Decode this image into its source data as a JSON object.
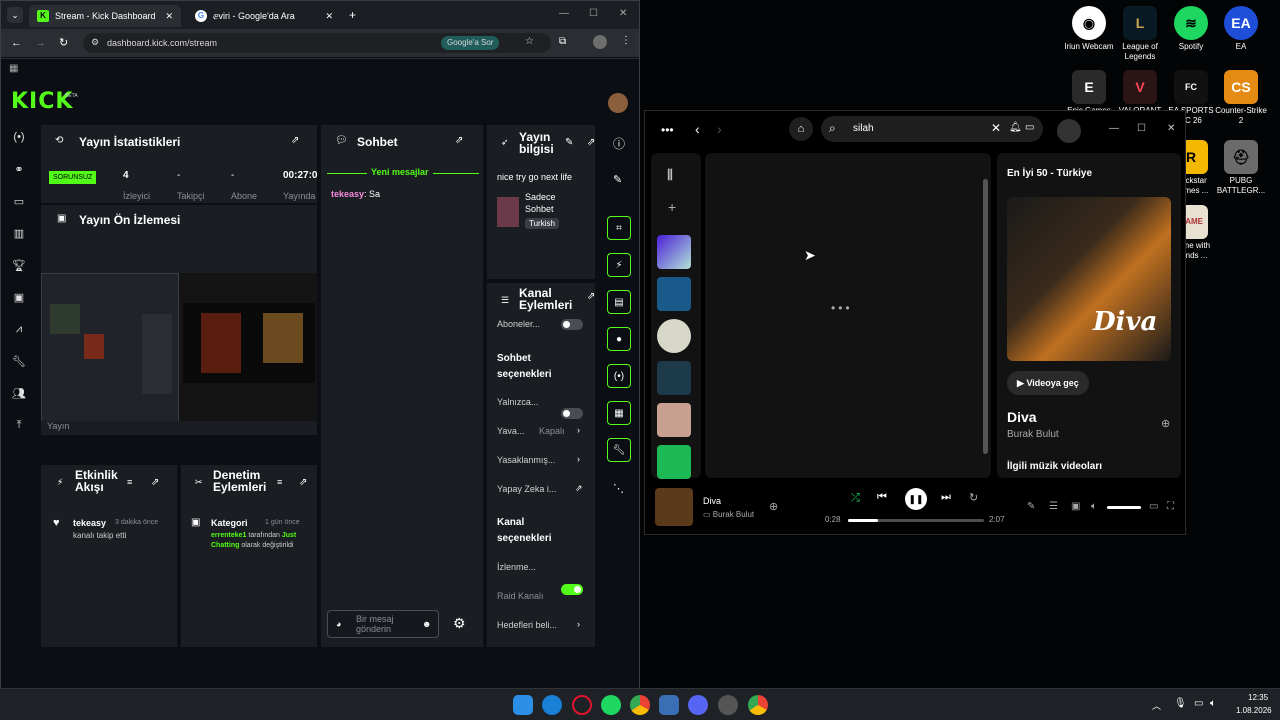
{
  "chrome": {
    "tab1": "Stream - Kick Dashboard",
    "tab2": "ⅇviri - Google'da Ara",
    "url": "dashboard.kick.com/stream",
    "ask_google": "Google'a Sor"
  },
  "kick": {
    "logo": "KICK",
    "beta": "BETA",
    "stats": {
      "title": "Yayın İstatistikleri",
      "badge": "SORUNSUZ",
      "viewers_val": "4",
      "viewers_lbl": "İzleyici",
      "followers_val": "-",
      "followers_lbl": "Takipçi",
      "subs_val": "-",
      "subs_lbl": "Abone",
      "time_val": "00:27:0",
      "time_lbl": "Yayında"
    },
    "preview": {
      "title": "Yayın Ön İzlemesi",
      "cut": "Yayın"
    },
    "chat": {
      "title": "Sohbet",
      "new_messages": "Yeni mesajlar",
      "user": "tekeasy",
      "msg": "Sa",
      "placeholder": "Bir mesaj gönderin"
    },
    "info": {
      "title": "Yayın bilgisi",
      "stream_title": "nice try go next life",
      "category": "Sadece Sohbet",
      "language": "Turkish"
    },
    "actions": {
      "title": "Kanal Eylemleri",
      "subs_only": "Aboneler...",
      "chat_options": "Sohbet seçenekleri",
      "only": "Yalnızca...",
      "slow": "Yava...",
      "slow_val": "Kapalı",
      "banned": "Yasaklanmış...",
      "ai": "Yapay Zeka i...",
      "channel_options": "Kanal seçenekleri",
      "watch": "İzlenme...",
      "raid": "Raid Kanalı",
      "goals": "Hedefleri beli..."
    },
    "activity": {
      "title": "Etkinlik Akışı",
      "user": "tekeasy",
      "time": "3 dakika önce",
      "text": "kanalı takip etti"
    },
    "mod": {
      "title": "Denetim Eylemleri",
      "kind": "Kategori",
      "time": "1 gün önce",
      "user": "errenteke1",
      "t1": "tarafından",
      "cat": "Just Chatting",
      "t2": "olarak değiştirildi"
    }
  },
  "desktop_icons": [
    "Iriun Webcam",
    "League of Legends",
    "Spotify",
    "EA",
    "Epic Games",
    "VALORANT",
    "EA SPORTS FC 26",
    "Counter-Strike 2",
    "Rockstar Games ...",
    "PUBG BATTLEGR...",
    "Game with friends ..."
  ],
  "spotify": {
    "search": "silah",
    "panel_title": "En İyi 50 - Türkiye",
    "art_text": "Diva",
    "video_btn": "Videoya geç",
    "song": "Diva",
    "artist": "Burak Bulut",
    "videos": "İlgili müzik videoları",
    "now_title": "Diva",
    "now_artist": "Burak Bulut",
    "elapsed": "0:28",
    "duration": "2:07",
    "progress": 0.22
  },
  "taskbar": {
    "time": "12:35",
    "date": "1.08.2026"
  }
}
